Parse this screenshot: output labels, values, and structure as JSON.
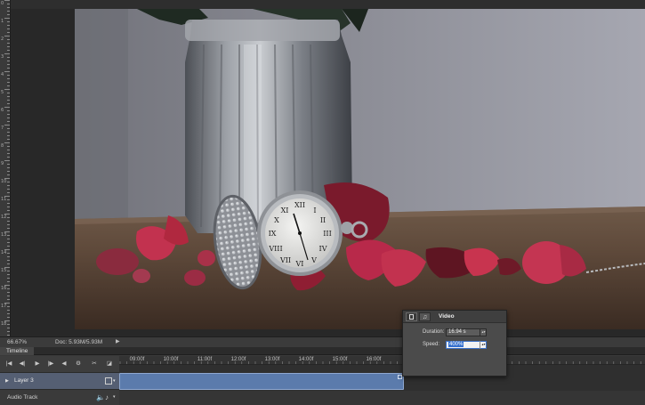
{
  "status_bar": {
    "zoom": "66.67%",
    "doc": "Doc: 5.93M/5.93M",
    "menu_arrow": "▶"
  },
  "ruler": {
    "labels": [
      "0",
      "1",
      "2",
      "3",
      "4",
      "5",
      "6",
      "7",
      "8",
      "9",
      "10",
      "11",
      "12",
      "13",
      "14",
      "15",
      "16",
      "17",
      "18"
    ]
  },
  "timeline": {
    "panel_label": "Timeline",
    "controls": {
      "first_frame": "|◀",
      "prev_frame": "◀|",
      "play": "▶",
      "next_frame": "|▶",
      "mute": "◀",
      "settings": "⚙",
      "split": "✂",
      "transition": "◪"
    },
    "time_labels": [
      "09:00f",
      "10:00f",
      "11:00f",
      "12:00f",
      "13:00f",
      "14:00f",
      "15:00f",
      "16:00f"
    ],
    "layer": {
      "name": "Layer 3",
      "expand": "▶",
      "menu": "▾"
    },
    "audio": {
      "name": "Audio Track",
      "speaker": "🔈",
      "note": "♪",
      "menu": "▾"
    }
  },
  "video_popup": {
    "title": "Video",
    "music_tab": "♫",
    "duration_label": "Duration:",
    "duration_value": "16.94 s",
    "speed_label": "Speed:",
    "speed_value": "400%",
    "spin": "▴▾"
  },
  "colors": {
    "selection": "#3671cf",
    "clip": "#5b7bac",
    "layer_row": "#555f73"
  }
}
